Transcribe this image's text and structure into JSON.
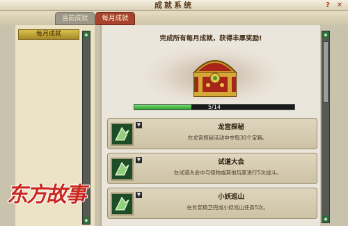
{
  "window": {
    "title": "成就系统",
    "help_label": "?",
    "close_label": "✕"
  },
  "tabs": [
    {
      "label": "当前成就",
      "active": false
    },
    {
      "label": "每月成就",
      "active": true
    }
  ],
  "sidebar": {
    "items": [
      {
        "label": "每月成就",
        "selected": true
      }
    ]
  },
  "main": {
    "headline": "完成所有每月成就，获得丰厚奖励!",
    "progress": {
      "current": 5,
      "total": 14,
      "text": "5/14"
    }
  },
  "achievements": [
    {
      "title": "龙宫探秘",
      "description": "在龙宫探秘活动中夺取30个宝箱。",
      "icon": "green-achievement-icon"
    },
    {
      "title": "试道大会",
      "description": "在试道大会中与怪物或其他玩家进行5次战斗。",
      "icon": "green-achievement-icon"
    },
    {
      "title": "小妖巡山",
      "description": "在长安精卫完成小妖巡山任务5次。",
      "icon": "green-achievement-icon"
    }
  ],
  "logo": {
    "text": "东方故事"
  },
  "colors": {
    "accent_tab": "#a8432e",
    "progress_fill": "#2c9c2c",
    "badge_bg": "#1d4d26"
  }
}
